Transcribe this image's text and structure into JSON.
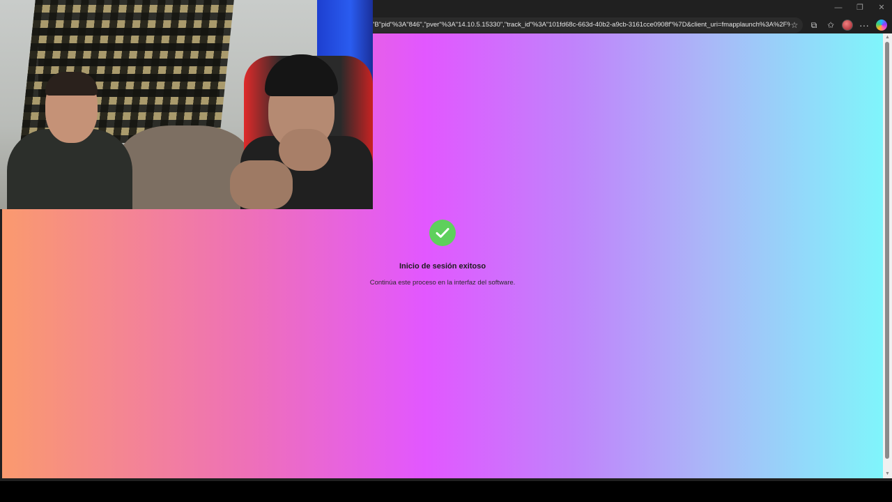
{
  "browser": {
    "window_controls": {
      "minimize": "—",
      "maximize": "❐",
      "close": "✕"
    },
    "address_bar": {
      "url": "\"B\"pid\"%3A\"846\",\"pver\"%3A\"14.10.5.15330\",\"track_id\"%3A\"101fd68c-663d-40b2-a9cb-3161cce0908f\"%7D&client_uri=fmapplaunch%3A%2F%..."
    },
    "toolbar_icons": {
      "star": "☆",
      "extensions": "⧉",
      "favorites": "✩",
      "more": "···"
    }
  },
  "page": {
    "title": "Inicio de sesión exitoso",
    "subtitle": "Continúa este proceso en la interfaz del software.",
    "colors": {
      "gradient": [
        "#fa9a6e",
        "#ee70b8",
        "#e257ff",
        "#c083fb",
        "#aab7f8",
        "#7ff5fb"
      ],
      "success": "#5ed05c"
    }
  },
  "icons": {
    "success": "check-circle-icon"
  }
}
